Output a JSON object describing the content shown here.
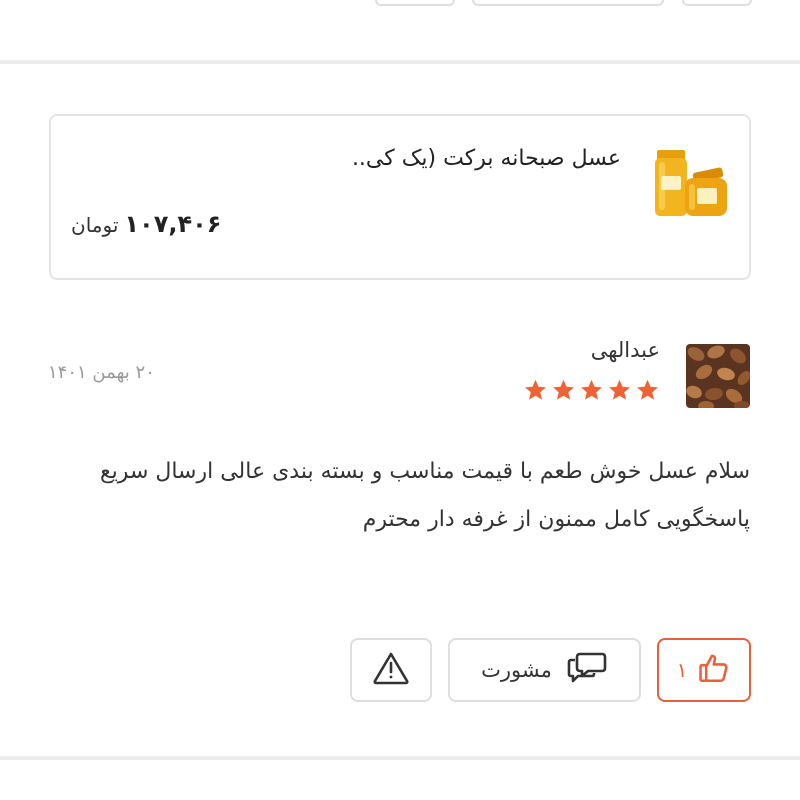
{
  "product": {
    "title": "عسل صبحانه برکت (یک کی..",
    "price": "۱۰۷,۴۰۶",
    "currency": "تومان",
    "thumbnail_icon": "honey-jar-icon"
  },
  "review": {
    "author": "عبدالهی",
    "date": "۲۰ بهمن ۱۴۰۱",
    "rating": 5,
    "rating_max": 5,
    "star_color": "#f06236",
    "avatar_icon": "nuts-avatar",
    "text": "سلام عسل خوش طعم با قیمت مناسب و بسته بندی عالی ارسال سریع پاسخگویی کامل ممنون از غرفه دار محترم"
  },
  "actions": {
    "like_count": "۱",
    "consult_label": "مشورت",
    "like_icon": "thumbs-up-icon",
    "consult_icon": "chat-bubbles-icon",
    "report_icon": "warning-icon"
  },
  "colors": {
    "accent": "#e8603c",
    "border": "#dedede",
    "divider": "#ececec"
  }
}
